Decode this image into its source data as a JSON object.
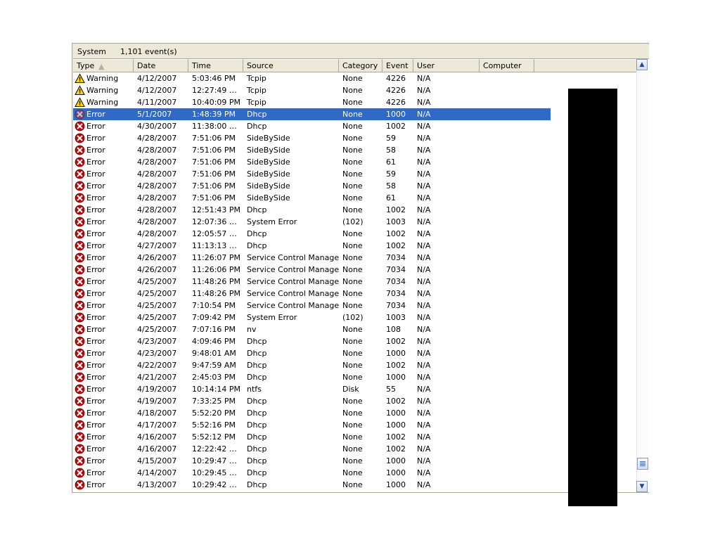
{
  "window": {
    "log_name": "System",
    "event_count": "1,101 event(s)"
  },
  "columns": [
    {
      "label": "Type",
      "sort": "ascending"
    },
    {
      "label": "Date",
      "sort": ""
    },
    {
      "label": "Time",
      "sort": ""
    },
    {
      "label": "Source",
      "sort": ""
    },
    {
      "label": "Category",
      "sort": ""
    },
    {
      "label": "Event",
      "sort": ""
    },
    {
      "label": "User",
      "sort": ""
    },
    {
      "label": "Computer",
      "sort": ""
    },
    {
      "label": "",
      "sort": ""
    }
  ],
  "sort_glyph": "▲",
  "icons": {
    "warning": "warning-triangle-icon",
    "error": "error-circle-icon",
    "scroll_up": "▲",
    "scroll_down": "▼"
  },
  "colors": {
    "selection_blue": "#316ac5",
    "warning_yellow": "#ffd800",
    "error_red": "#cc0000",
    "window_face": "#ece9d8",
    "redaction_black": "#000000"
  },
  "redaction": {
    "name": "computer-column-redaction",
    "note": "Computer column values obscured by solid black block"
  },
  "rows": [
    {
      "type": "Warning",
      "icon": "warning",
      "date": "4/12/2007",
      "time": "5:03:46 PM",
      "source": "Tcpip",
      "category": "None",
      "event": "4226",
      "user": "N/A",
      "computer": "",
      "selected": false
    },
    {
      "type": "Warning",
      "icon": "warning",
      "date": "4/12/2007",
      "time": "12:27:49 …",
      "source": "Tcpip",
      "category": "None",
      "event": "4226",
      "user": "N/A",
      "computer": "",
      "selected": false
    },
    {
      "type": "Warning",
      "icon": "warning",
      "date": "4/11/2007",
      "time": "10:40:09 PM",
      "source": "Tcpip",
      "category": "None",
      "event": "4226",
      "user": "N/A",
      "computer": "",
      "selected": false
    },
    {
      "type": "Error",
      "icon": "error",
      "date": "5/1/2007",
      "time": "1:48:39 PM",
      "source": "Dhcp",
      "category": "None",
      "event": "1000",
      "user": "N/A",
      "computer": "",
      "selected": true
    },
    {
      "type": "Error",
      "icon": "error",
      "date": "4/30/2007",
      "time": "11:38:00 …",
      "source": "Dhcp",
      "category": "None",
      "event": "1002",
      "user": "N/A",
      "computer": "",
      "selected": false
    },
    {
      "type": "Error",
      "icon": "error",
      "date": "4/28/2007",
      "time": "7:51:06 PM",
      "source": "SideBySide",
      "category": "None",
      "event": "59",
      "user": "N/A",
      "computer": "",
      "selected": false
    },
    {
      "type": "Error",
      "icon": "error",
      "date": "4/28/2007",
      "time": "7:51:06 PM",
      "source": "SideBySide",
      "category": "None",
      "event": "58",
      "user": "N/A",
      "computer": "",
      "selected": false
    },
    {
      "type": "Error",
      "icon": "error",
      "date": "4/28/2007",
      "time": "7:51:06 PM",
      "source": "SideBySide",
      "category": "None",
      "event": "61",
      "user": "N/A",
      "computer": "",
      "selected": false
    },
    {
      "type": "Error",
      "icon": "error",
      "date": "4/28/2007",
      "time": "7:51:06 PM",
      "source": "SideBySide",
      "category": "None",
      "event": "59",
      "user": "N/A",
      "computer": "",
      "selected": false
    },
    {
      "type": "Error",
      "icon": "error",
      "date": "4/28/2007",
      "time": "7:51:06 PM",
      "source": "SideBySide",
      "category": "None",
      "event": "58",
      "user": "N/A",
      "computer": "",
      "selected": false
    },
    {
      "type": "Error",
      "icon": "error",
      "date": "4/28/2007",
      "time": "7:51:06 PM",
      "source": "SideBySide",
      "category": "None",
      "event": "61",
      "user": "N/A",
      "computer": "",
      "selected": false
    },
    {
      "type": "Error",
      "icon": "error",
      "date": "4/28/2007",
      "time": "12:51:43 PM",
      "source": "Dhcp",
      "category": "None",
      "event": "1002",
      "user": "N/A",
      "computer": "",
      "selected": false
    },
    {
      "type": "Error",
      "icon": "error",
      "date": "4/28/2007",
      "time": "12:07:36 …",
      "source": "System Error",
      "category": "(102)",
      "event": "1003",
      "user": "N/A",
      "computer": "",
      "selected": false
    },
    {
      "type": "Error",
      "icon": "error",
      "date": "4/28/2007",
      "time": "12:05:57 …",
      "source": "Dhcp",
      "category": "None",
      "event": "1002",
      "user": "N/A",
      "computer": "",
      "selected": false
    },
    {
      "type": "Error",
      "icon": "error",
      "date": "4/27/2007",
      "time": "11:13:13 …",
      "source": "Dhcp",
      "category": "None",
      "event": "1002",
      "user": "N/A",
      "computer": "",
      "selected": false
    },
    {
      "type": "Error",
      "icon": "error",
      "date": "4/26/2007",
      "time": "11:26:07 PM",
      "source": "Service Control Manager",
      "category": "None",
      "event": "7034",
      "user": "N/A",
      "computer": "",
      "selected": false
    },
    {
      "type": "Error",
      "icon": "error",
      "date": "4/26/2007",
      "time": "11:26:06 PM",
      "source": "Service Control Manager",
      "category": "None",
      "event": "7034",
      "user": "N/A",
      "computer": "",
      "selected": false
    },
    {
      "type": "Error",
      "icon": "error",
      "date": "4/25/2007",
      "time": "11:48:26 PM",
      "source": "Service Control Manager",
      "category": "None",
      "event": "7034",
      "user": "N/A",
      "computer": "",
      "selected": false
    },
    {
      "type": "Error",
      "icon": "error",
      "date": "4/25/2007",
      "time": "11:48:26 PM",
      "source": "Service Control Manager",
      "category": "None",
      "event": "7034",
      "user": "N/A",
      "computer": "",
      "selected": false
    },
    {
      "type": "Error",
      "icon": "error",
      "date": "4/25/2007",
      "time": "7:10:54 PM",
      "source": "Service Control Manager",
      "category": "None",
      "event": "7034",
      "user": "N/A",
      "computer": "",
      "selected": false
    },
    {
      "type": "Error",
      "icon": "error",
      "date": "4/25/2007",
      "time": "7:09:42 PM",
      "source": "System Error",
      "category": "(102)",
      "event": "1003",
      "user": "N/A",
      "computer": "",
      "selected": false
    },
    {
      "type": "Error",
      "icon": "error",
      "date": "4/25/2007",
      "time": "7:07:16 PM",
      "source": "nv",
      "category": "None",
      "event": "108",
      "user": "N/A",
      "computer": "",
      "selected": false
    },
    {
      "type": "Error",
      "icon": "error",
      "date": "4/23/2007",
      "time": "4:09:46 PM",
      "source": "Dhcp",
      "category": "None",
      "event": "1002",
      "user": "N/A",
      "computer": "",
      "selected": false
    },
    {
      "type": "Error",
      "icon": "error",
      "date": "4/23/2007",
      "time": "9:48:01 AM",
      "source": "Dhcp",
      "category": "None",
      "event": "1000",
      "user": "N/A",
      "computer": "",
      "selected": false
    },
    {
      "type": "Error",
      "icon": "error",
      "date": "4/22/2007",
      "time": "9:47:59 AM",
      "source": "Dhcp",
      "category": "None",
      "event": "1002",
      "user": "N/A",
      "computer": "",
      "selected": false
    },
    {
      "type": "Error",
      "icon": "error",
      "date": "4/21/2007",
      "time": "2:45:03 PM",
      "source": "Dhcp",
      "category": "None",
      "event": "1000",
      "user": "N/A",
      "computer": "",
      "selected": false
    },
    {
      "type": "Error",
      "icon": "error",
      "date": "4/19/2007",
      "time": "10:14:14 PM",
      "source": "ntfs",
      "category": "Disk",
      "event": "55",
      "user": "N/A",
      "computer": "",
      "selected": false
    },
    {
      "type": "Error",
      "icon": "error",
      "date": "4/19/2007",
      "time": "7:33:25 PM",
      "source": "Dhcp",
      "category": "None",
      "event": "1002",
      "user": "N/A",
      "computer": "",
      "selected": false
    },
    {
      "type": "Error",
      "icon": "error",
      "date": "4/18/2007",
      "time": "5:52:20 PM",
      "source": "Dhcp",
      "category": "None",
      "event": "1000",
      "user": "N/A",
      "computer": "",
      "selected": false
    },
    {
      "type": "Error",
      "icon": "error",
      "date": "4/17/2007",
      "time": "5:52:16 PM",
      "source": "Dhcp",
      "category": "None",
      "event": "1000",
      "user": "N/A",
      "computer": "",
      "selected": false
    },
    {
      "type": "Error",
      "icon": "error",
      "date": "4/16/2007",
      "time": "5:52:12 PM",
      "source": "Dhcp",
      "category": "None",
      "event": "1002",
      "user": "N/A",
      "computer": "",
      "selected": false
    },
    {
      "type": "Error",
      "icon": "error",
      "date": "4/16/2007",
      "time": "12:22:42 …",
      "source": "Dhcp",
      "category": "None",
      "event": "1002",
      "user": "N/A",
      "computer": "",
      "selected": false
    },
    {
      "type": "Error",
      "icon": "error",
      "date": "4/15/2007",
      "time": "10:29:47 …",
      "source": "Dhcp",
      "category": "None",
      "event": "1000",
      "user": "N/A",
      "computer": "",
      "selected": false
    },
    {
      "type": "Error",
      "icon": "error",
      "date": "4/14/2007",
      "time": "10:29:45 …",
      "source": "Dhcp",
      "category": "None",
      "event": "1000",
      "user": "N/A",
      "computer": "",
      "selected": false
    },
    {
      "type": "Error",
      "icon": "error",
      "date": "4/13/2007",
      "time": "10:29:42 …",
      "source": "Dhcp",
      "category": "None",
      "event": "1000",
      "user": "N/A",
      "computer": "",
      "selected": false
    }
  ]
}
